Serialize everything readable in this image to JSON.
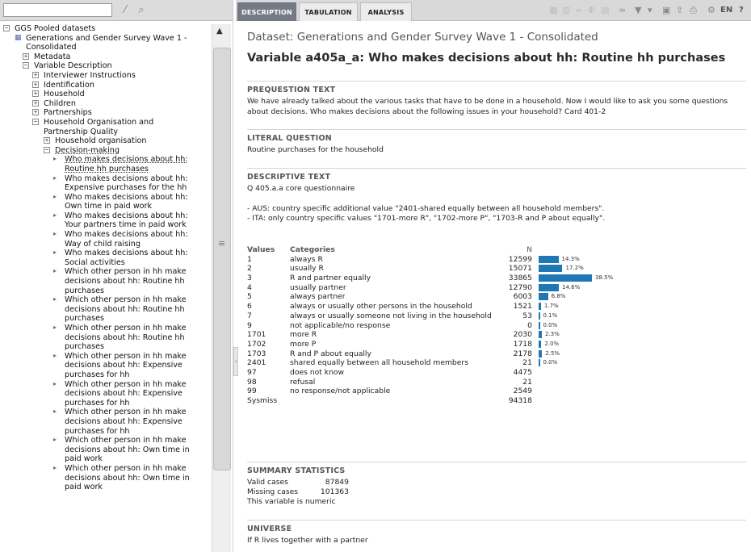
{
  "search": {
    "placeholder": ""
  },
  "tree": {
    "root": "GGS Pooled datasets",
    "dataset": "Generations and Gender Survey Wave 1 - Consolidated",
    "metadata": "Metadata",
    "variable_description": "Variable Description",
    "groups": [
      "Interviewer Instructions",
      "Identification",
      "Household",
      "Children",
      "Partnerships"
    ],
    "hh_org_group": "Household Organisation and Partnership Quality",
    "hh_org_sub": "Household organisation",
    "decision_group": "Decision-making",
    "variables": [
      "Who makes decisions about hh: Routine hh purchases",
      "Who makes decisions about hh: Expensive purchases for the hh",
      "Who makes decisions about hh: Own time in paid work",
      "Who makes decisions about hh: Your partners time in paid work",
      "Who makes decisions about hh: Way of child raising",
      "Who makes decisions about hh: Social activities",
      "Which other person in hh make decisions about hh: Routine hh purchases",
      "Which other person in hh make decisions about hh: Routine hh purchases",
      "Which other person in hh make decisions about hh: Routine hh purchases",
      "Which other person in hh make decisions about hh: Expensive purchases for hh",
      "Which other person in hh make decisions about hh: Expensive purchases for hh",
      "Which other person in hh make decisions about hh: Expensive purchases for hh",
      "Which other person in hh make decisions about hh: Own time in paid work",
      "Which other person in hh make decisions about hh: Own time in paid work"
    ]
  },
  "tabs": [
    "DESCRIPTION",
    "TABULATION",
    "ANALYSIS"
  ],
  "toolbar": {
    "language": "EN",
    "help": "?"
  },
  "main": {
    "dataset_title": "Dataset: Generations and Gender Survey Wave 1 - Consolidated",
    "variable_title": "Variable a405a_a: Who makes decisions about hh: Routine hh purchases",
    "prequestion": {
      "heading": "PREQUESTION TEXT",
      "text": "We have already talked about the various tasks that have to be done in a household. Now I would like to ask you some questions about decisions. Who makes decisions about the following issues in your household? Card 401-2"
    },
    "literal": {
      "heading": "LITERAL QUESTION",
      "text": "Routine purchases for the household"
    },
    "descriptive": {
      "heading": "DESCRIPTIVE TEXT",
      "line1": "Q 405.a.a core questionnaire",
      "line2": "- AUS: country specific additional value \"2401-shared equally between all household members\".",
      "line3": "- ITA: only country specific values \"1701-more R\", \"1702-more P\", \"1703-R and P about equally\"."
    },
    "values_table": {
      "headers": {
        "values": "Values",
        "categories": "Categories",
        "n": "N"
      },
      "rows": [
        {
          "value": "1",
          "category": "always R",
          "n": "12599",
          "pct": "14.3%",
          "frac": 0.143
        },
        {
          "value": "2",
          "category": "usually R",
          "n": "15071",
          "pct": "17.2%",
          "frac": 0.172
        },
        {
          "value": "3",
          "category": "R and partner equally",
          "n": "33865",
          "pct": "38.5%",
          "frac": 0.385
        },
        {
          "value": "4",
          "category": "usually partner",
          "n": "12790",
          "pct": "14.6%",
          "frac": 0.146
        },
        {
          "value": "5",
          "category": "always partner",
          "n": "6003",
          "pct": "6.8%",
          "frac": 0.068
        },
        {
          "value": "6",
          "category": "always or usually other persons in the household",
          "n": "1521",
          "pct": "1.7%",
          "frac": 0.017
        },
        {
          "value": "7",
          "category": "always or usually someone not living in the household",
          "n": "53",
          "pct": "0.1%",
          "frac": 0.001
        },
        {
          "value": "9",
          "category": "not applicable/no response",
          "n": "0",
          "pct": "0.0%",
          "frac": 0
        },
        {
          "value": "1701",
          "category": "more R",
          "n": "2030",
          "pct": "2.3%",
          "frac": 0.023
        },
        {
          "value": "1702",
          "category": "more P",
          "n": "1718",
          "pct": "2.0%",
          "frac": 0.02
        },
        {
          "value": "1703",
          "category": "R and P about equally",
          "n": "2178",
          "pct": "2.5%",
          "frac": 0.025
        },
        {
          "value": "2401",
          "category": "shared equally between all household members",
          "n": "21",
          "pct": "0.0%",
          "frac": 0
        },
        {
          "value": "97",
          "category": "does not know",
          "n": "4475",
          "pct": "",
          "frac": null
        },
        {
          "value": "98",
          "category": "refusal",
          "n": "21",
          "pct": "",
          "frac": null
        },
        {
          "value": "99",
          "category": "no response/not applicable",
          "n": "2549",
          "pct": "",
          "frac": null
        },
        {
          "value": "Sysmiss",
          "category": "",
          "n": "94318",
          "pct": "",
          "frac": null
        }
      ],
      "bar_color": "#1f78b4"
    },
    "summary": {
      "heading": "SUMMARY STATISTICS",
      "valid_label": "Valid cases",
      "valid_value": "87849",
      "missing_label": "Missing cases",
      "missing_value": "101363",
      "note": "This variable is numeric"
    },
    "universe": {
      "heading": "UNIVERSE",
      "text": "If R lives together with a partner"
    }
  }
}
